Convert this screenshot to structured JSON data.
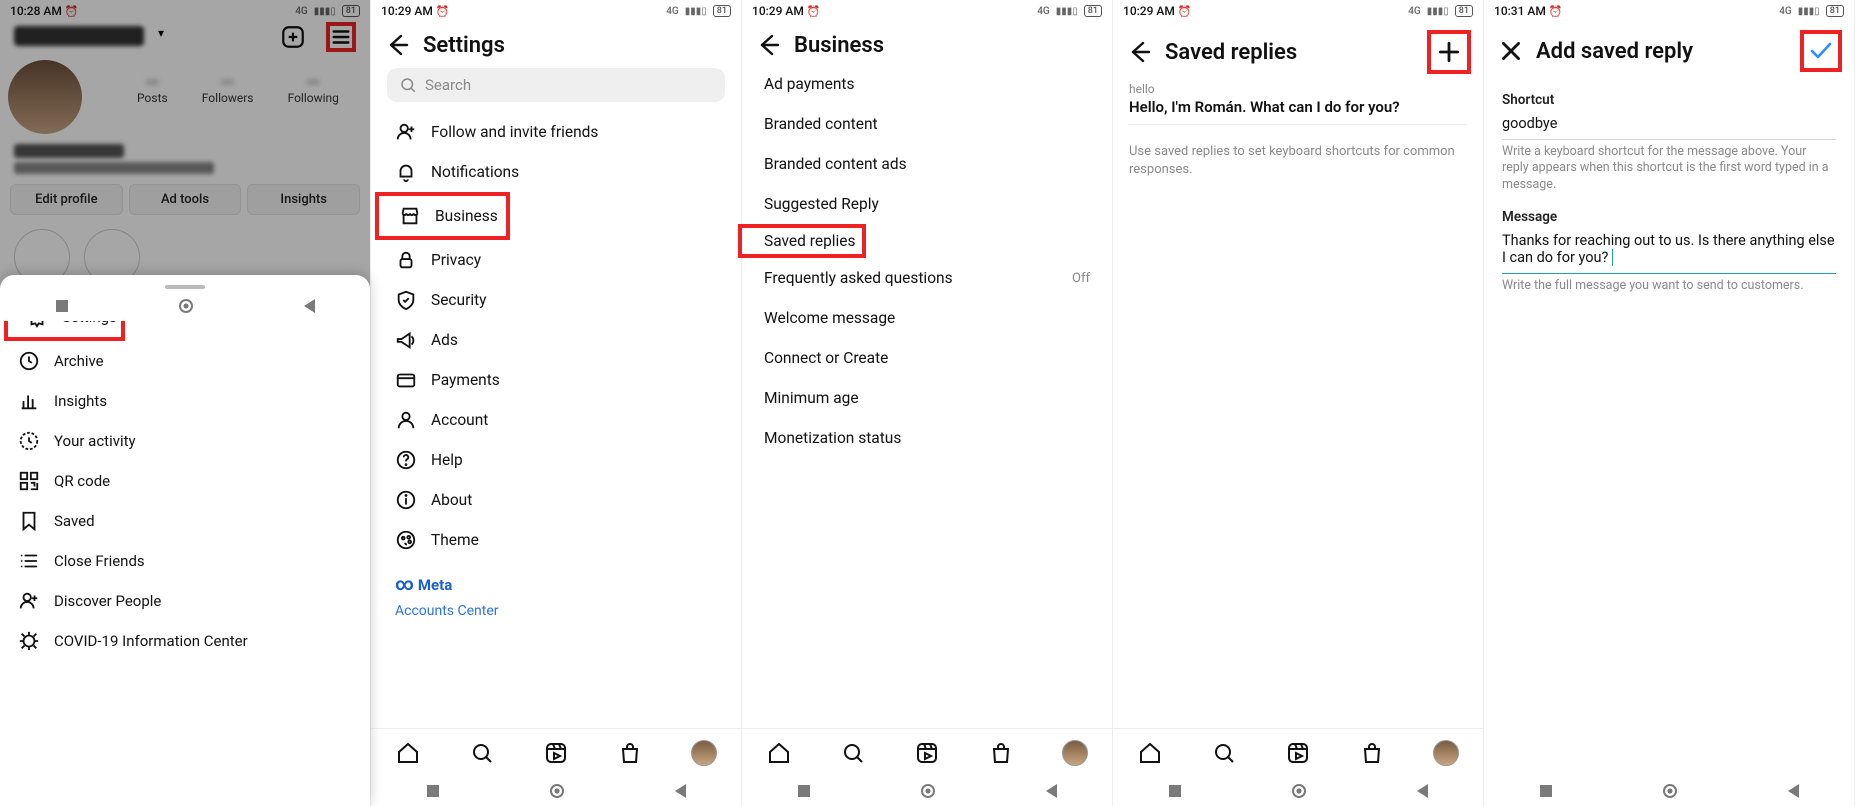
{
  "status": {
    "t1": "10:28 AM",
    "t2": "10:29 AM",
    "t3": "10:29 AM",
    "t4": "10:29 AM",
    "t5": "10:31 AM",
    "net": "4G",
    "batt": "81"
  },
  "p1": {
    "edit": "Edit profile",
    "adtools": "Ad tools",
    "insights": "Insights",
    "menu": {
      "settings": "Settings",
      "archive": "Archive",
      "insights": "Insights",
      "activity": "Your activity",
      "qr": "QR code",
      "saved": "Saved",
      "close": "Close Friends",
      "discover": "Discover People",
      "covid": "COVID-19 Information Center"
    }
  },
  "p2": {
    "title": "Settings",
    "search_ph": "Search",
    "items": {
      "follow": "Follow and invite friends",
      "notifications": "Notifications",
      "business": "Business",
      "privacy": "Privacy",
      "security": "Security",
      "ads": "Ads",
      "payments": "Payments",
      "account": "Account",
      "help": "Help",
      "about": "About",
      "theme": "Theme"
    },
    "meta": "Meta",
    "accounts": "Accounts Center"
  },
  "p3": {
    "title": "Business",
    "items": {
      "adpay": "Ad payments",
      "branded": "Branded content",
      "brandedads": "Branded content ads",
      "suggested": "Suggested Reply",
      "saved": "Saved replies",
      "faq": "Frequently asked questions",
      "faq_trail": "Off",
      "welcome": "Welcome message",
      "connect": "Connect or Create",
      "minage": "Minimum age",
      "monet": "Monetization status"
    }
  },
  "p4": {
    "title": "Saved replies",
    "shortcut": "hello",
    "message": "Hello, I'm Román. What can I do for you?",
    "hint": "Use saved replies to set keyboard shortcuts for common responses."
  },
  "p5": {
    "title": "Add saved reply",
    "shortcut_label": "Shortcut",
    "shortcut_value": "goodbye",
    "shortcut_caption": "Write a keyboard shortcut for the message above. Your reply appears when this shortcut is the first word typed in a message.",
    "message_label": "Message",
    "message_value": "Thanks for reaching out to us. Is there anything else I can do for you?",
    "message_caption": "Write the full message you want to send to customers."
  }
}
